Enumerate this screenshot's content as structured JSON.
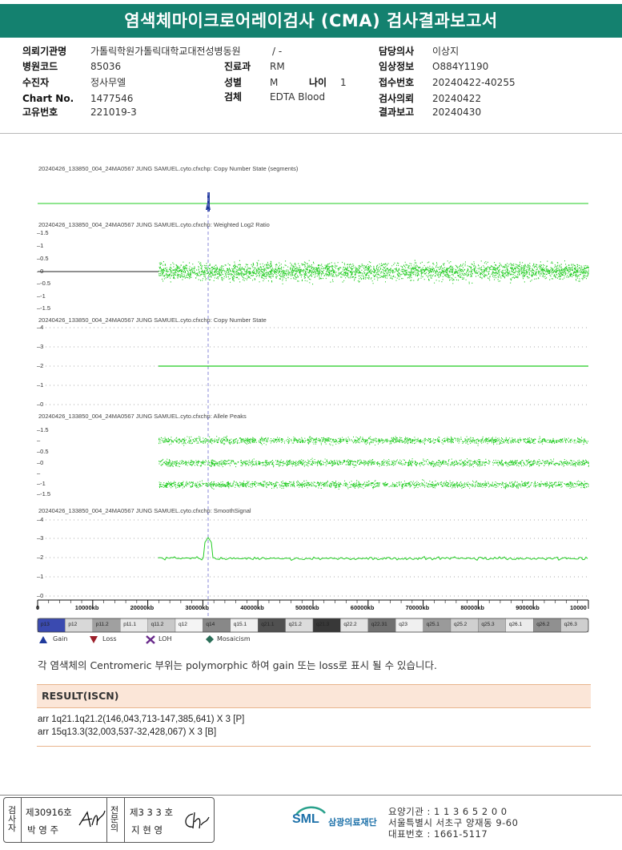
{
  "report": {
    "title": "염색체마이크로어레이검사 (CMA) 검사결과보고서"
  },
  "patient": {
    "hospital_label": "의뢰기관명",
    "hospital_value": "가톨릭학원가톨릭대학교대전성병동원",
    "ward_value": "/ -",
    "doctor_label": "담당의사",
    "doctor_value": "이상지",
    "code_label": "병원코드",
    "code_value": "85036",
    "dept_label": "진료과",
    "dept_value": "RM",
    "clinical_label": "임상정보",
    "clinical_value": "O884Y1190",
    "name_label": "수진자",
    "name_value": "정사무엘",
    "sex_label": "성별",
    "sex_value": "M",
    "age_label": "나이",
    "age_value": "1",
    "receipt_label": "접수번호",
    "receipt_value": "20240422-40255",
    "chart_label": "Chart No.",
    "chart_value": "1477546",
    "specimen_label": "검체",
    "specimen_value": "EDTA Blood",
    "request_label": "검사의뢰",
    "request_value": "20240422",
    "id_label": "고유번호",
    "id_value": "221019-3",
    "result_date_label": "결과보고",
    "result_date_value": "20240430"
  },
  "plot": {
    "panel1_title": "20240426_133850_004_24MA0567 JUNG SAMUEL.cyto.cfxchp: Copy Number State (segments)",
    "panel2_title": "20240426_133850_004_24MA0567 JUNG SAMUEL.cyto.cfxchp: Weighted Log2 Ratio",
    "panel3_title": "20240426_133850_004_24MA0567 JUNG SAMUEL.cyto.cfxchp: Copy Number State",
    "panel4_title": "20240426_133850_004_24MA0567 JUNG SAMUEL.cyto.cfxchp: Allele Peaks",
    "panel5_title": "20240426_133850_004_24MA0567 JUNG SAMUEL.cyto.cfxchp: SmoothSignal",
    "panel2_yticks": [
      "1.5",
      "1",
      "0.5",
      "0",
      "-0.5",
      "-1",
      "-1.5"
    ],
    "panel3_yticks": [
      "4",
      "3",
      "2",
      "1",
      "0"
    ],
    "panel4_yticks": [
      "1.5",
      "",
      "0.5",
      "0",
      "",
      "-1",
      "-1.5"
    ],
    "panel5_yticks": [
      "4",
      "3",
      "2",
      "1",
      "0"
    ],
    "xticks": [
      "0",
      "10000kb",
      "20000kb",
      "30000kb",
      "40000kb",
      "50000kb",
      "60000kb",
      "70000kb",
      "80000kb",
      "90000kb",
      "10000"
    ],
    "bands": [
      {
        "label": "p13"
      },
      {
        "label": "p12"
      },
      {
        "label": "p11.2"
      },
      {
        "label": "p11.1"
      },
      {
        "label": "q11.2"
      },
      {
        "label": "q12"
      },
      {
        "label": "q14"
      },
      {
        "label": "q15.1"
      },
      {
        "label": "q21.1"
      },
      {
        "label": "q21.2"
      },
      {
        "label": "q21.3"
      },
      {
        "label": "q22.2"
      },
      {
        "label": "q22.31"
      },
      {
        "label": "q23"
      },
      {
        "label": "q25.1"
      },
      {
        "label": "q25.2"
      },
      {
        "label": "q25.3"
      },
      {
        "label": "q26.1"
      },
      {
        "label": "q26.2"
      },
      {
        "label": "q26.3"
      }
    ],
    "legend": {
      "gain": "Gain",
      "loss": "Loss",
      "loh": "LOH",
      "mosaicism": "Mosaicism"
    },
    "colors": {
      "signal": "#22cc22",
      "gain": "#1f3a9c",
      "loss": "#9c1f2a",
      "loh": "#6a2c8c",
      "mosaic": "#2a6e58"
    }
  },
  "note": "각 염색체의 Centromeric 부위는 polymorphic 하여 gain 또는 loss로 표시 될 수 있습니다.",
  "result": {
    "heading": "RESULT(ISCN)",
    "line1": "arr 1q21.1q21.2(146,043,713-147,385,641) X 3 [P]",
    "line2": "arr 15q13.3(32,003,537-32,428,067) X 3 [B]"
  },
  "signatures": {
    "inspector_label": "검사자",
    "inspector_no": "제30916호",
    "inspector_name": "박 영 주",
    "reviewer_label": "전문의",
    "reviewer_no": "제3 3 3 호",
    "reviewer_name": "지 현 영"
  },
  "footer": {
    "logo": "SML",
    "org": "삼광의료재단",
    "line1": "요양기관 : 1 1 3 6 5 2 0 0",
    "line2": "서울특별시 서초구 양재동 9-60",
    "line3": "대표번호 : 1661-5117"
  }
}
